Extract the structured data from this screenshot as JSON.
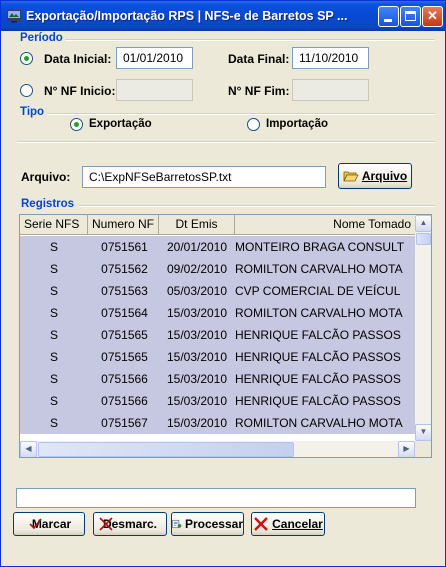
{
  "window": {
    "title": "Exportação/Importação RPS  |  NFS-e de Barretos SP ..."
  },
  "periodo": {
    "label": "Período",
    "data_inicial_label": "Data Inicial:",
    "data_inicial_value": "01/01/2010",
    "data_final_label": "Data Final:",
    "data_final_value": "11/10/2010",
    "nf_inicio_label": "N° NF Inicio:",
    "nf_inicio_value": "",
    "nf_fim_label": "N° NF Fim:",
    "nf_fim_value": ""
  },
  "tipo": {
    "label": "Tipo",
    "exportacao_label": "Exportação",
    "importacao_label": "Importação",
    "selected": "Exportação"
  },
  "arquivo": {
    "label": "Arquivo:",
    "value": "C:\\ExpNFSeBarretosSP.txt",
    "button_label": "Arquivo"
  },
  "registros": {
    "label": "Registros",
    "columns": [
      "Serie NFS",
      "Numero NF",
      "Dt Emis",
      "Nome Tomado"
    ],
    "rows": [
      [
        "S",
        "0751561",
        "20/01/2010",
        "MONTEIRO BRAGA CONSULT"
      ],
      [
        "S",
        "0751562",
        "09/02/2010",
        "ROMILTON CARVALHO MOTA"
      ],
      [
        "S",
        "0751563",
        "05/03/2010",
        "CVP COMERCIAL DE VEÍCUL"
      ],
      [
        "S",
        "0751564",
        "15/03/2010",
        "ROMILTON CARVALHO MOTA"
      ],
      [
        "S",
        "0751565",
        "15/03/2010",
        "HENRIQUE FALCÃO PASSOS"
      ],
      [
        "S",
        "0751565",
        "15/03/2010",
        "HENRIQUE FALCÃO PASSOS"
      ],
      [
        "S",
        "0751566",
        "15/03/2010",
        "HENRIQUE FALCÃO PASSOS"
      ],
      [
        "S",
        "0751566",
        "15/03/2010",
        "HENRIQUE FALCÃO PASSOS"
      ],
      [
        "S",
        "0751567",
        "15/03/2010",
        "ROMILTON CARVALHO MOTA"
      ]
    ]
  },
  "status": {
    "text": ""
  },
  "buttons": {
    "marcar": "Marcar",
    "desmarc": "Desmarc.",
    "processar": "Processar",
    "cancelar": "Cancelar"
  },
  "colors": {
    "group_label": "#0046d5",
    "row_highlight": "#c6c7e1",
    "titlebar": "#0a52dc"
  }
}
